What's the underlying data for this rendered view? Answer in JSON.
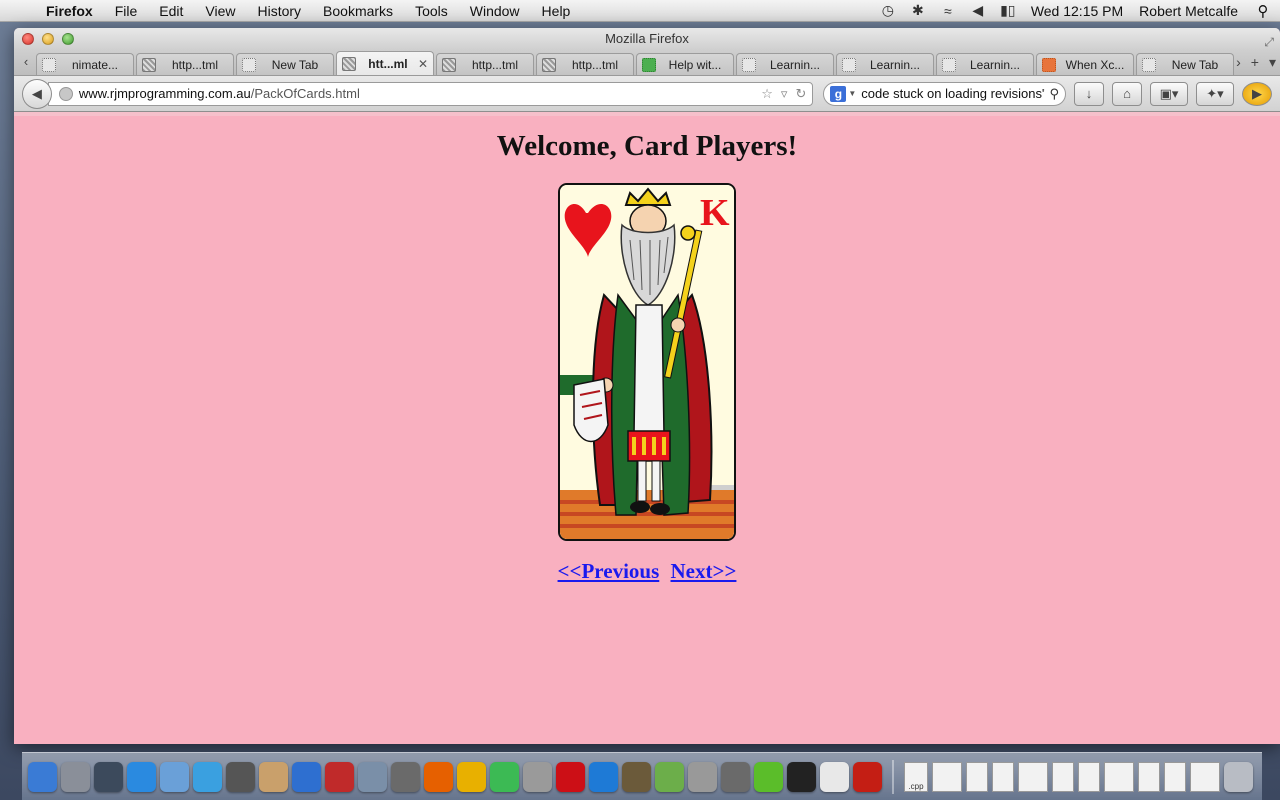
{
  "menubar": {
    "app_name": "Firefox",
    "menus": [
      "File",
      "Edit",
      "View",
      "History",
      "Bookmarks",
      "Tools",
      "Window",
      "Help"
    ],
    "clock": "Wed 12:15 PM",
    "user": "Robert Metcalfe"
  },
  "window": {
    "title": "Mozilla Firefox"
  },
  "tabs": [
    {
      "label": "nimate...",
      "favicon": "blank"
    },
    {
      "label": "http...tml",
      "favicon": "image"
    },
    {
      "label": "New Tab",
      "favicon": "blank"
    },
    {
      "label": "htt...ml",
      "favicon": "image",
      "active": true
    },
    {
      "label": "http...tml",
      "favicon": "image"
    },
    {
      "label": "http...tml",
      "favicon": "image"
    },
    {
      "label": "Help wit...",
      "favicon": "green"
    },
    {
      "label": "Learnin...",
      "favicon": "blank"
    },
    {
      "label": "Learnin...",
      "favicon": "blank"
    },
    {
      "label": "Learnin...",
      "favicon": "blank"
    },
    {
      "label": "When Xc...",
      "favicon": "orange"
    },
    {
      "label": "New Tab",
      "favicon": "blank"
    }
  ],
  "address_bar": {
    "host": "www.rjmprogramming.com.au",
    "path": "/PackOfCards.html"
  },
  "search_bar": {
    "engine": "Google",
    "value": "code stuck on loading revisions\""
  },
  "page": {
    "heading": "Welcome, Card Players!",
    "card": {
      "rank": "K",
      "suit": "hearts",
      "suit_color": "#e8141c"
    },
    "previous_link": "<<Previous",
    "next_link": "Next>>",
    "background_color": "#f9b0c0",
    "link_color": "#1a1aee"
  },
  "dock": {
    "apps": [
      "Finder",
      "Launchpad",
      "Mission Control",
      "App Store",
      "Preview",
      "Safari",
      "FaceTime",
      "Address Book",
      "iTunes",
      "Photo Booth",
      "iPhoto",
      "Image Capture",
      "Firefox",
      "Wireshark",
      "Chrome",
      "Script Editor",
      "Opera",
      "Xcode",
      "GIMP",
      "Photos",
      "Help",
      "Growl",
      "Brackets",
      "Terminal",
      "TextEdit",
      "Acrobat"
    ],
    "docs": [
      ".cpp"
    ]
  }
}
